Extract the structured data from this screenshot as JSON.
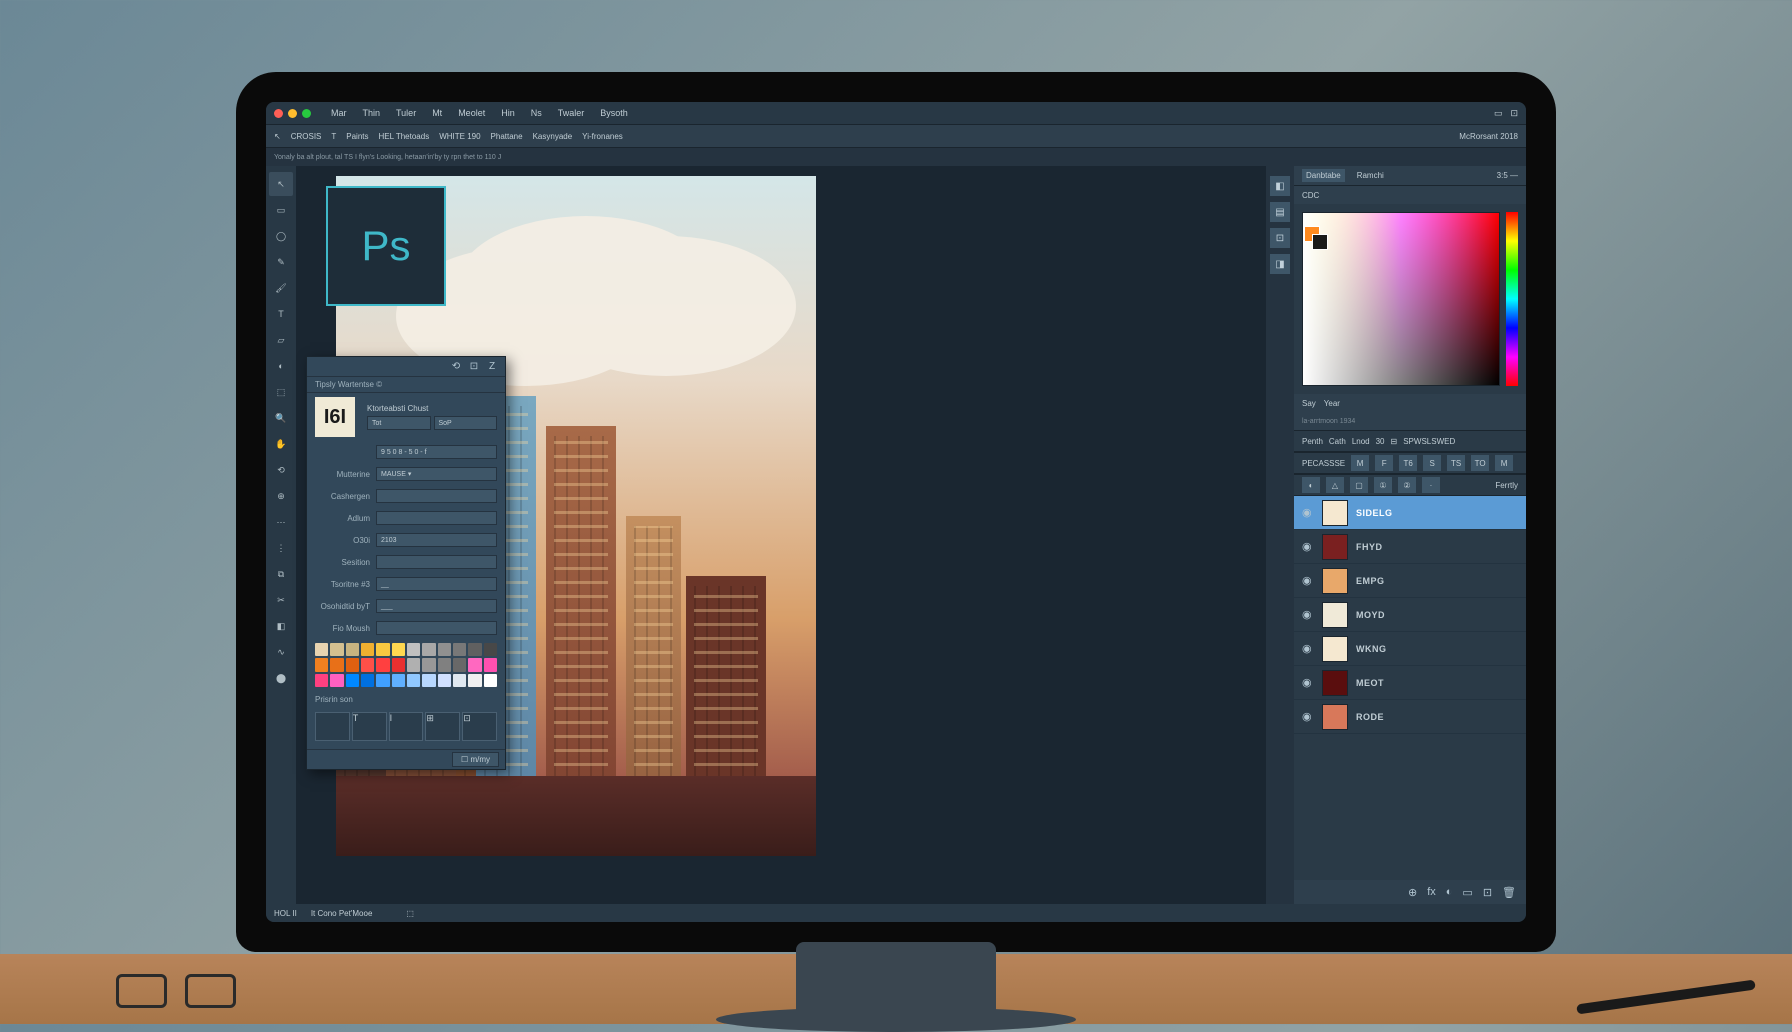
{
  "menubar": {
    "items": [
      "Mar",
      "Thin",
      "Tuler",
      "Mt",
      "Meolet",
      "Hin",
      "Ns",
      "Twaler",
      "Bysoth"
    ]
  },
  "optbar": {
    "items": [
      "↖",
      "CROSIS",
      "T",
      "Paints",
      "HEL Thetoads",
      "WHITE 190",
      "Phattane",
      "Kasynyade",
      "Yi-fronanes"
    ],
    "right_label": "McRorsant 2018"
  },
  "infobar": "Yonaly ba alt plout, tal TS I flyn's Looking, hetaan'in'by ty rpn thet to 110 J",
  "tools": [
    "↖",
    "▭",
    "◯",
    "✎",
    "🖌",
    "T",
    "▱",
    "◐",
    "⬚",
    "🔍",
    "✋",
    "⟲",
    "⊕",
    "⋯",
    "⋮",
    "⧉",
    "✂",
    "◧",
    "∿",
    "⬤"
  ],
  "ps_logo": "Ps",
  "floatpanel": {
    "header_icons": [
      "⟲",
      "⊡",
      "Z"
    ],
    "subtitle": "Tipsly Wartentse ©",
    "id_logo": "I6I",
    "top": {
      "label": "Ktorteabsti Chust",
      "btn1": "Tot",
      "btn2": "SoP"
    },
    "rows": [
      {
        "label": "",
        "value": "9 5 0 8  - 5  0 - f"
      },
      {
        "label": "Mutterine",
        "value": "MAUSE ▾"
      },
      {
        "label": "Cashergen",
        "value": ""
      },
      {
        "label": "Adlum",
        "value": ""
      },
      {
        "label": "O30i",
        "value": "2103"
      },
      {
        "label": "Sesition",
        "value": ""
      },
      {
        "label": "Tsoritne #3",
        "value": "__"
      },
      {
        "label": "Osohidtid byT",
        "value": "___"
      },
      {
        "label": "Fio Moush",
        "value": ""
      }
    ],
    "swatch_label": "Prisrin son",
    "swatches": [
      "#e8d4b0",
      "#d4c090",
      "#c8b480",
      "#f0b030",
      "#f8c840",
      "#ffd850",
      "#c0c0c0",
      "#a8a8a8",
      "#909090",
      "#787878",
      "#606060",
      "#484848",
      "#f08020",
      "#e87018",
      "#e06010",
      "#ff5048",
      "#ff4040",
      "#e83030",
      "#b0b0b0",
      "#989898",
      "#808080",
      "#686868",
      "#ff68c0",
      "#ff50b0",
      "#ff4080",
      "#ff60c0",
      "#0088ff",
      "#0070e0",
      "#40a0ff",
      "#60b0ff",
      "#90c8ff",
      "#b8d8ff",
      "#d0e0ff",
      "#e0e8f0",
      "#f0f0f0",
      "#ffffff"
    ],
    "presets": [
      "",
      "T",
      "I",
      "⊞",
      "⊡"
    ],
    "foot_button": "☐ m/my"
  },
  "right": {
    "nav_tabs": [
      "Danbtabe",
      "Ramchi",
      "3:5 —"
    ],
    "nav_sub": "CDC",
    "dock": [
      "◧",
      "▤",
      "⊡",
      "◨"
    ],
    "tabs2": [
      "Say",
      "Year"
    ],
    "subinfo": "la-arrtmoon 1934",
    "ctrlbar": {
      "left": "Penth",
      "items": [
        "Cath",
        "Lnod",
        "30",
        "⊟",
        "SPWSLSWED"
      ]
    },
    "ctrlbar2": {
      "left": "PECASSSE",
      "icons": [
        "M",
        "F",
        "T6",
        "S",
        "TS",
        "TO",
        "M"
      ]
    },
    "ctrlbar3": {
      "icons": [
        "◐",
        "△",
        "▢",
        "①",
        "②",
        "·"
      ],
      "right": "Ferrtly"
    },
    "layers": [
      {
        "name": "SIDELG",
        "color": "#f5e8d0",
        "sel": true
      },
      {
        "name": "FHYD",
        "color": "#7a2020"
      },
      {
        "name": "EMPG",
        "color": "#e8a86a"
      },
      {
        "name": "MOYD",
        "color": "#f0ead8"
      },
      {
        "name": "WKNG",
        "color": "#f5e8d0"
      },
      {
        "name": "MEOT",
        "color": "#5a0e0e"
      },
      {
        "name": "RODE",
        "color": "#d8785a"
      }
    ],
    "footer_icons": [
      "⊕",
      "fx",
      "◐",
      "▭",
      "⊡",
      "🗑"
    ]
  },
  "statusbar": {
    "left": "HOL II",
    "mid": "It Cono Pet'Mooe",
    "right": "⬚"
  },
  "colors": {
    "fg": "#ff8a1e",
    "bg": "#1a1a1a"
  }
}
